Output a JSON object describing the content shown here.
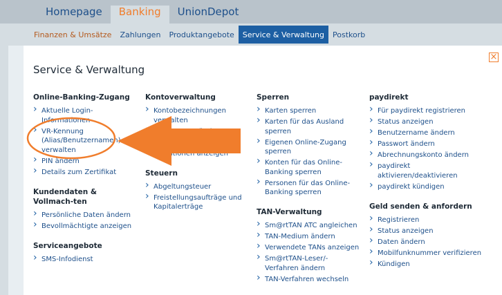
{
  "top_nav": {
    "tabs": [
      {
        "label": "Homepage"
      },
      {
        "label": "Banking"
      },
      {
        "label": "UnionDepot"
      }
    ]
  },
  "sub_nav": {
    "items": [
      {
        "label": "Finanzen & Umsätze"
      },
      {
        "label": "Zahlungen"
      },
      {
        "label": "Produktangebote"
      },
      {
        "label": "Service & Verwaltung"
      },
      {
        "label": "Postkorb"
      }
    ]
  },
  "panel": {
    "title": "Service & Verwaltung",
    "close_glyph": "×"
  },
  "columns": {
    "col1": {
      "groups": [
        {
          "heading": "Online-Banking-Zugang",
          "links": [
            "Aktuelle Login-Informationen",
            "VR-Kennung (Alias/Benutzernamen) verwalten",
            "PIN ändern",
            "Details zum Zertifikat"
          ]
        },
        {
          "heading": "Kundendaten & Vollmach-ten",
          "links": [
            "Persönliche Daten ändern",
            "Bevollmächtigte anzeigen"
          ]
        },
        {
          "heading": "Serviceangebote",
          "links": [
            "SMS-Infodienst"
          ]
        }
      ]
    },
    "col2": {
      "groups": [
        {
          "heading": "Kontoverwaltung",
          "links": [
            "Kontobezeichnungen verwalten",
            "Tagesgrenze ändern",
            "Konditionen ändern",
            "Konditionen anzeigen"
          ]
        },
        {
          "heading": "Steuern",
          "links": [
            "Abgeltungsteuer",
            "Freistellungsaufträge und Kapitalerträge"
          ]
        }
      ]
    },
    "col3": {
      "groups": [
        {
          "heading": "Sperren",
          "links": [
            "Karten sperren",
            "Karten für das Ausland sperren",
            "Eigenen Online-Zugang sperren",
            "Konten für das Online-Banking sperren",
            "Personen für das Online-Banking sperren"
          ]
        },
        {
          "heading": "TAN-Verwaltung",
          "links": [
            "Sm@rtTAN ATC angleichen",
            "TAN-Medium ändern",
            "Verwendete TANs anzeigen",
            "Sm@rtTAN-Leser/-Verfahren ändern",
            "TAN-Verfahren wechseln"
          ]
        }
      ]
    },
    "col4": {
      "groups": [
        {
          "heading": "paydirekt",
          "links": [
            "Für paydirekt registrieren",
            "Status anzeigen",
            "Benutzername ändern",
            "Passwort ändern",
            "Abrechnungskonto ändern",
            "paydirekt aktivieren/deaktivieren",
            "paydirekt kündigen"
          ]
        },
        {
          "heading": "Geld senden & anfordern",
          "links": [
            "Registrieren",
            "Status anzeigen",
            "Daten ändern",
            "Mobilfunknummer verifizieren",
            "Kündigen"
          ]
        }
      ]
    }
  },
  "colors": {
    "accent_orange": "#f07d2c",
    "link_blue": "#1d4f8a",
    "active_blue": "#1d5fa3"
  }
}
